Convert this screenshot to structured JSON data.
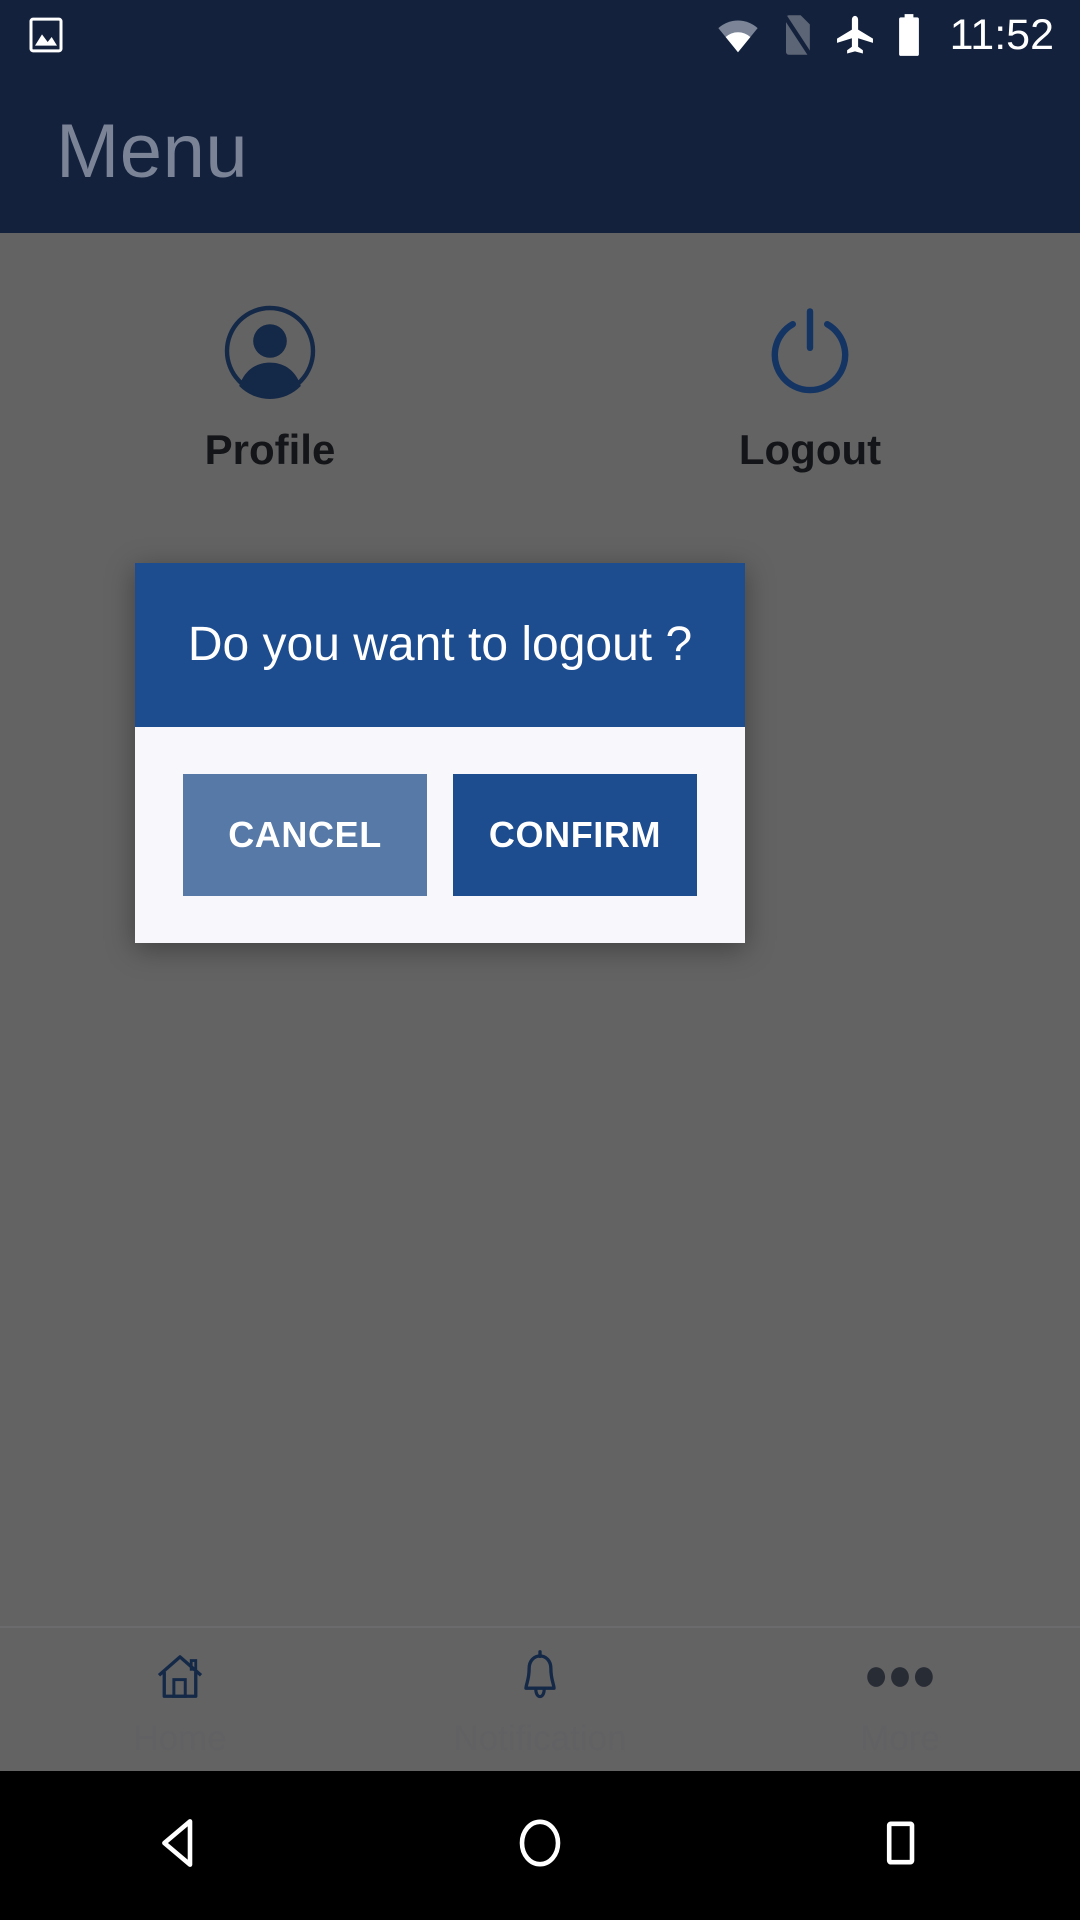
{
  "status_bar": {
    "left_icons": [
      {
        "name": "screenshot-icon",
        "label": "screenshot"
      }
    ],
    "right_icons": [
      {
        "name": "wifi-icon",
        "label": "wifi"
      },
      {
        "name": "no-sim-icon",
        "label": "no-sim"
      },
      {
        "name": "airplane-mode-icon",
        "label": "airplane-mode"
      },
      {
        "name": "battery-icon",
        "label": "battery-full"
      }
    ],
    "clock": "11:52",
    "background_color": "#13213c",
    "text_color": "#ffffff"
  },
  "app_bar": {
    "title": "Menu",
    "background_color": "#13213c",
    "title_color": "#7b8497"
  },
  "menu": {
    "items": [
      {
        "icon": "profile-icon",
        "label": "Profile"
      },
      {
        "icon": "power-icon",
        "label": "Logout"
      }
    ],
    "icon_color": "#1d3a66",
    "label_color": "#1d1f24"
  },
  "dialog": {
    "title": "Do you want to logout ?",
    "header_color": "#1d4c8f",
    "body_color": "#f8f8fc",
    "buttons": [
      {
        "label": "CANCEL",
        "name": "cancel-button",
        "color": "#5679a8"
      },
      {
        "label": "CONFIRM",
        "name": "confirm-button",
        "color": "#1d4c8f"
      }
    ]
  },
  "tab_bar": {
    "tabs": [
      {
        "icon": "home-icon",
        "label": "Home"
      },
      {
        "icon": "bell-icon",
        "label": "Notification"
      },
      {
        "icon": "more-dots-icon",
        "label": "More"
      }
    ],
    "label_color": "#8b8b90",
    "icon_color": "#1d3a66"
  },
  "nav_bar": {
    "buttons": [
      {
        "icon": "back-triangle-icon",
        "label": "Back"
      },
      {
        "icon": "home-circle-icon",
        "label": "Home"
      },
      {
        "icon": "recents-square-icon",
        "label": "Recents"
      }
    ],
    "background_color": "#000000",
    "icon_color": "#ffffff"
  }
}
